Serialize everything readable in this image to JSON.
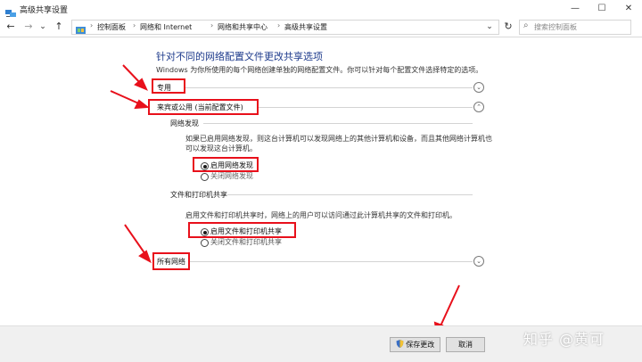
{
  "window": {
    "title": "高级共享设置"
  },
  "toolbar": {
    "back_icon": "←",
    "forward_icon": "→",
    "dropdown_icon": "⌄",
    "up_icon": "↑",
    "refresh_icon": "↻",
    "addr_dropdown_icon": "⌄",
    "min_icon": "—",
    "max_icon": "☐",
    "close_icon": "✕"
  },
  "breadcrumbs": [
    "控制面板",
    "网络和 Internet",
    "网络和共享中心",
    "高级共享设置"
  ],
  "breadcrumb_separator": "›",
  "search": {
    "placeholder": "搜索控制面板",
    "icon": "⌕"
  },
  "main": {
    "heading": "针对不同的网络配置文件更改共享选项",
    "description": "Windows 为你所使用的每个网络创建单独的网络配置文件。你可以针对每个配置文件选择特定的选项。",
    "profiles": [
      {
        "label": "专用",
        "chevron": "⌄"
      },
      {
        "label": "来宾或公用 (当前配置文件)",
        "chevron": "⌃"
      },
      {
        "label": "所有网络",
        "chevron": "⌄"
      }
    ],
    "network_discovery": {
      "title": "网络发现",
      "text_line1": "如果已启用网络发现，则这台计算机可以发现网络上的其他计算机和设备，而且其他网络计算机也",
      "text_line2": "可以发现这台计算机。",
      "options": [
        {
          "label": "启用网络发现",
          "selected": true
        },
        {
          "label": "关闭网络发现",
          "selected": false
        }
      ]
    },
    "file_printer_sharing": {
      "title": "文件和打印机共享",
      "text": "启用文件和打印机共享时，网络上的用户可以访问通过此计算机共享的文件和打印机。",
      "options": [
        {
          "label": "启用文件和打印机共享",
          "selected": true
        },
        {
          "label": "关闭文件和打印机共享",
          "selected": false
        }
      ]
    }
  },
  "footer": {
    "save_label": "保存更改",
    "cancel_label": "取消",
    "shield_icon": "shield"
  },
  "watermark": "知乎 @黄可",
  "colors": {
    "annotation_red": "#e8101b",
    "heading_blue": "#1e3b8c"
  }
}
